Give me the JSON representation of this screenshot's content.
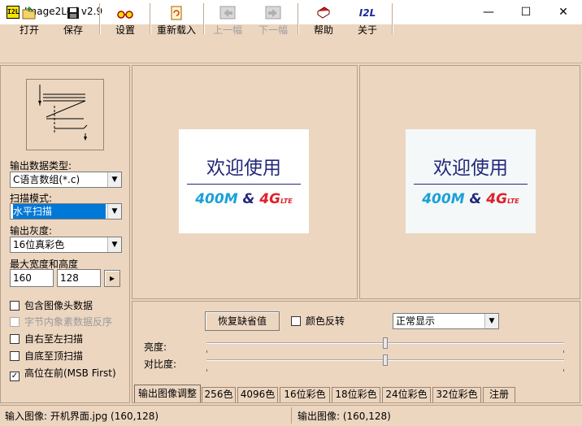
{
  "app": {
    "title": "Image2Lcd v2.9",
    "icon_text": "I2L"
  },
  "window_controls": {
    "minimize": "—",
    "maximize": "☐",
    "close": "✕"
  },
  "toolbar": {
    "open": "打开",
    "save": "保存",
    "settings": "设置",
    "reload": "重新载入",
    "prev": "上一幅",
    "next": "下一幅",
    "help": "帮助",
    "about": "关于",
    "about_icon": "I2L"
  },
  "left": {
    "output_type_label": "输出数据类型:",
    "output_type_value": "C语言数组(*.c)",
    "scan_mode_label": "扫描模式:",
    "scan_mode_value": "水平扫描",
    "gray_label": "输出灰度:",
    "gray_value": "16位真彩色",
    "max_size_label": "最大宽度和高度",
    "max_width": "160",
    "max_height": "128",
    "arrow_btn": "▸",
    "checkboxes": [
      {
        "label": "包含图像头数据",
        "checked": false,
        "disabled": false
      },
      {
        "label": "字节内象素数据反序",
        "checked": false,
        "disabled": true
      },
      {
        "label": "自右至左扫描",
        "checked": false,
        "disabled": false
      },
      {
        "label": "自底至顶扫描",
        "checked": false,
        "disabled": false
      },
      {
        "label": "高位在前(MSB First)",
        "checked": true,
        "disabled": false
      }
    ]
  },
  "preview": {
    "input_title": "欢迎使用",
    "input_400": "400M",
    "input_amp": "&",
    "input_4g": "4G",
    "input_lte": "LTE"
  },
  "controls": {
    "restore_btn": "恢复缺省值",
    "invert_label": "颜色反转",
    "display_mode": "正常显示",
    "brightness_label": "亮度:",
    "contrast_label": "对比度:",
    "brightness_level": 0.5,
    "contrast_level": 0.5
  },
  "tabs": [
    "输出图像调整",
    "256色",
    "4096色",
    "16位彩色",
    "18位彩色",
    "24位彩色",
    "32位彩色",
    "注册"
  ],
  "status": {
    "input": "输入图像: 开机界面.jpg (160,128)",
    "output": "输出图像: (160,128)"
  },
  "colors": {
    "background": "#ecd6c0",
    "selection": "#0078d7",
    "title_blue": "#23287a",
    "brand_cyan": "#1aa0d8",
    "brand_red": "#e0202a"
  }
}
